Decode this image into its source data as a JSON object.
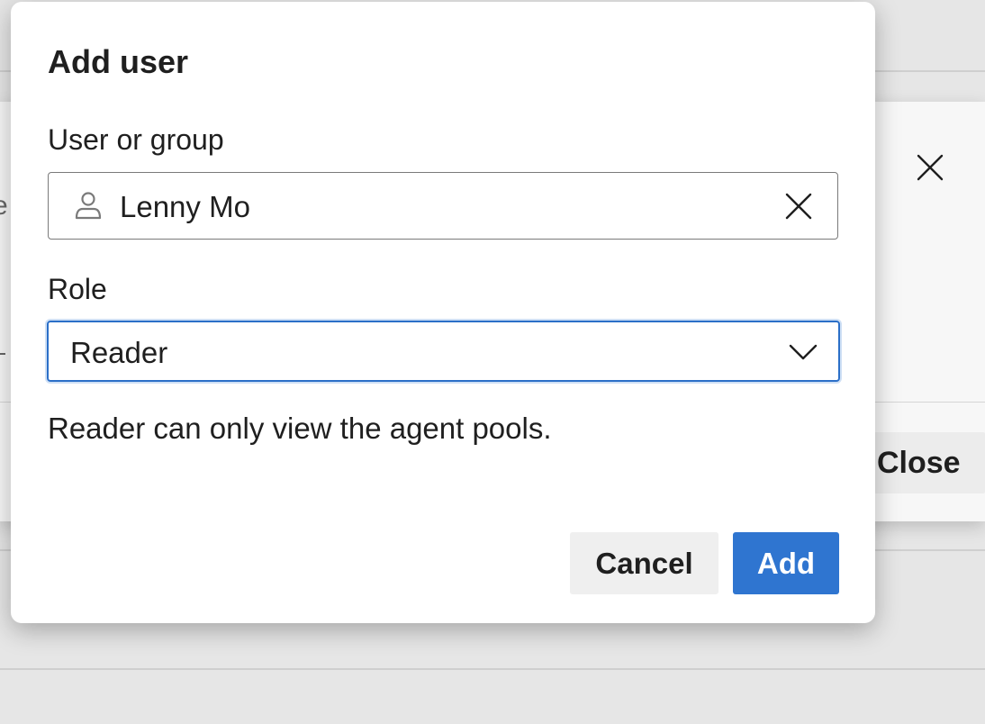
{
  "dialog": {
    "title": "Add user",
    "user_field": {
      "label": "User or group",
      "value": "Lenny Mo",
      "icon": "user-icon",
      "clear_icon": "close-icon"
    },
    "role_field": {
      "label": "Role",
      "selected": "Reader",
      "icon": "chevron-down-icon"
    },
    "role_description": "Reader can only view the agent pools.",
    "buttons": {
      "cancel": "Cancel",
      "add": "Add"
    }
  },
  "background_panel": {
    "close_label": "Close",
    "close_icon": "close-icon",
    "edge_char": "e"
  },
  "colors": {
    "accent": "#2f75d0",
    "focus_border": "#2b6fc8",
    "text": "#1f1f1f"
  }
}
